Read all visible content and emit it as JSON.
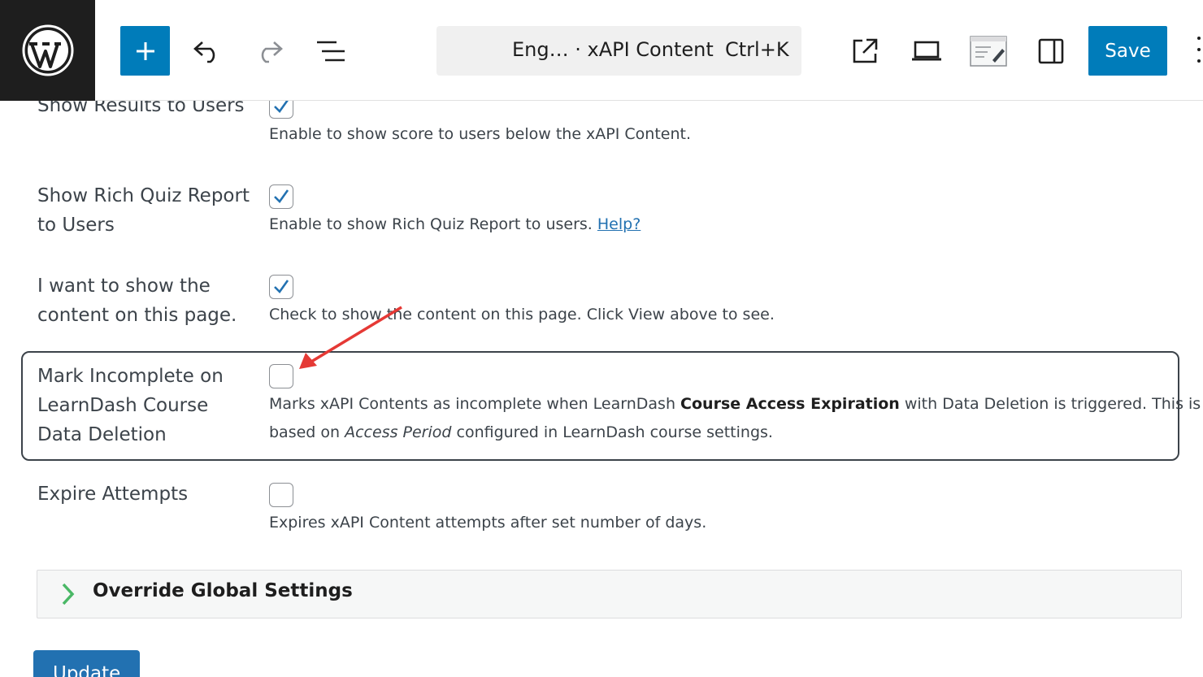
{
  "toolbar": {
    "doc_title": "Eng… · xAPI Content",
    "shortcut": "Ctrl+K",
    "save_label": "Save"
  },
  "settings": [
    {
      "label": "Show Results to Users",
      "checked": true,
      "description": "Enable to show score to users below the xAPI Content."
    },
    {
      "label": "Show Rich Quiz Report to Users",
      "checked": true,
      "description": "Enable to show Rich Quiz Report to users.",
      "help_link": "Help?"
    },
    {
      "label": "I want to show the content on this page.",
      "checked": true,
      "description": "Check to show the content on this page. Click View above to see."
    },
    {
      "label": "Mark Incomplete on LearnDash Course Data Deletion",
      "checked": false,
      "description_parts": {
        "p1": "Marks xAPI Contents as incomplete when LearnDash ",
        "bold": "Course Access Expiration",
        "p2": " with Data Deletion is triggered. This is",
        "p3": "based on ",
        "italic": "Access Period",
        "p4": " configured in LearnDash course settings."
      }
    },
    {
      "label": "Expire Attempts",
      "checked": false,
      "description": "Expires xAPI Content attempts after set number of days."
    }
  ],
  "override": {
    "label": "Override Global Settings"
  },
  "update_label": "Update",
  "colors": {
    "accent": "#007cba",
    "annotation_arrow": "#e53935",
    "check": "#2271b1",
    "override_chevron": "#4ab866"
  }
}
